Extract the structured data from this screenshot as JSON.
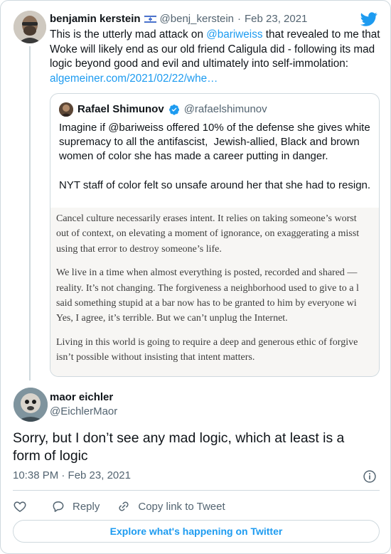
{
  "parent_tweet": {
    "author_name": "benjamin kerstein",
    "author_handle": "@benj_kerstein",
    "separator": "·",
    "date": "Feb 23, 2021",
    "text_before_mention": "This is the utterly mad attack on ",
    "mention": "@bariweiss",
    "text_after_mention": " that revealed to me that Woke will likely end as our old friend Caligula did - following its mad logic beyond good and evil and ultimately into self-immolation: ",
    "link": "algemeiner.com/2021/02/22/whe…",
    "flag_icon": "israel-flag-icon"
  },
  "quoted_tweet": {
    "author_name": "Rafael Shimunov",
    "author_handle": "@rafaelshimunov",
    "text": "Imagine if @bariweiss offered 10% of the defense she gives white supremacy to all the antifascist,  Jewish-allied, Black and brown women of color she has made a career putting in danger.\n\nNYT staff of color felt so unsafe around her that she had to resign.",
    "image_paragraphs": [
      [
        "Cancel culture necessarily erases intent. It relies on taking someone’s worst",
        "out of context, on elevating a moment of ignorance, on exaggerating a misst",
        "using that error to destroy someone’s life."
      ],
      [
        "We live in a time when almost everything is posted, recorded and shared —",
        "reality. It’s not changing. The forgiveness a neighborhood used to give to a l",
        "said something stupid at a bar now has to be granted to him by everyone wi",
        "Yes, I agree, it’s terrible. But we can’t unplug the Internet."
      ],
      [
        "Living in this world is going to require a deep and generous ethic of forgive",
        "isn’t possible without insisting that intent matters."
      ]
    ]
  },
  "reply_tweet": {
    "author_name": "maor eichler",
    "author_handle": "@EichlerMaor",
    "text": "Sorry, but I don’t see any mad logic, which at least is a form of logic",
    "timestamp": "10:38 PM · Feb 23, 2021"
  },
  "actions": {
    "reply_label": "Reply",
    "copy_link_label": "Copy link to Tweet",
    "explore_label": "Explore what's happening on Twitter"
  },
  "colors": {
    "accent": "#1d9bf0",
    "text": "#0f1419",
    "muted": "#536471",
    "border": "#cfd9de"
  }
}
